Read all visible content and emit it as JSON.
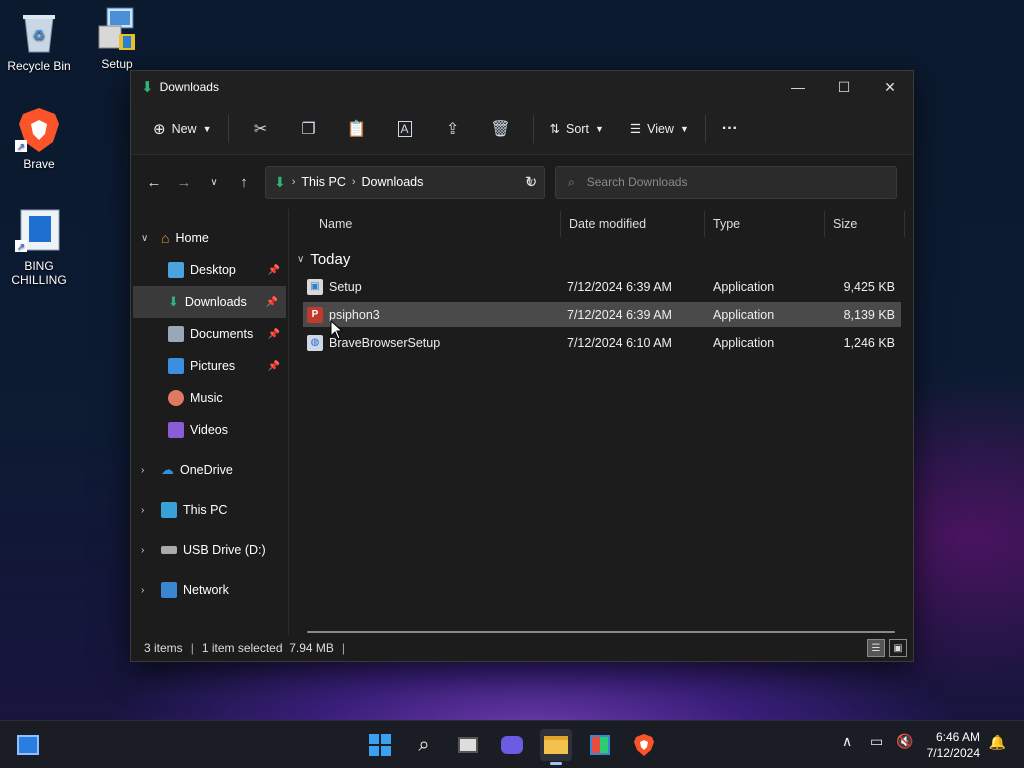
{
  "desktop": {
    "icons": [
      {
        "label": "Recycle Bin",
        "icon": "recycle-bin-icon"
      },
      {
        "label": "Setup",
        "icon": "setup-installer-icon"
      },
      {
        "label": "Brave",
        "icon": "brave-icon"
      },
      {
        "label": "BING CHILLING",
        "icon": "document-shortcut-icon"
      }
    ]
  },
  "window": {
    "title": "Downloads",
    "controls": {
      "minimize": "—",
      "maximize": "☐",
      "close": "✕"
    }
  },
  "toolbar": {
    "new_label": "New",
    "sort_label": "Sort",
    "view_label": "View",
    "more_label": "···",
    "icons": [
      "cut-icon",
      "copy-icon",
      "paste-icon",
      "rename-icon",
      "share-icon",
      "delete-icon"
    ]
  },
  "addressbar": {
    "crumbs": [
      "This PC",
      "Downloads"
    ],
    "search_placeholder": "Search Downloads"
  },
  "navpane": {
    "home": "Home",
    "quick": [
      {
        "label": "Desktop",
        "color": "#4aa3df",
        "pinned": true
      },
      {
        "label": "Downloads",
        "color": "#2fb37a",
        "pinned": true,
        "selected": true
      },
      {
        "label": "Documents",
        "color": "#9aa7b8",
        "pinned": true
      },
      {
        "label": "Pictures",
        "color": "#3b8ee0",
        "pinned": true
      },
      {
        "label": "Music",
        "color": "#e07a5f",
        "pinned": false
      },
      {
        "label": "Videos",
        "color": "#8a5cd6",
        "pinned": false
      }
    ],
    "roots": [
      {
        "label": "OneDrive",
        "color": "#2f8fe0"
      },
      {
        "label": "This PC",
        "color": "#3aa0d8"
      },
      {
        "label": "USB Drive (D:)",
        "color": "#aaaaaa"
      },
      {
        "label": "Network",
        "color": "#3a86d0"
      }
    ]
  },
  "columns": {
    "name": "Name",
    "date": "Date modified",
    "type": "Type",
    "size": "Size"
  },
  "group": "Today",
  "files": [
    {
      "name": "Setup",
      "date": "7/12/2024 6:39 AM",
      "type": "Application",
      "size": "9,425 KB",
      "selected": false,
      "icon": "setup-app-icon"
    },
    {
      "name": "psiphon3",
      "date": "7/12/2024 6:39 AM",
      "type": "Application",
      "size": "8,139 KB",
      "selected": true,
      "icon": "psiphon-icon"
    },
    {
      "name": "BraveBrowserSetup",
      "date": "7/12/2024 6:10 AM",
      "type": "Application",
      "size": "1,246 KB",
      "selected": false,
      "icon": "installer-icon"
    }
  ],
  "status": {
    "count": "3 items",
    "selection": "1 item selected  7.94 MB"
  },
  "taskbar": {
    "apps": [
      "windows-start-icon",
      "search-icon",
      "task-view-icon",
      "chat-icon",
      "file-explorer-icon",
      "store-icon",
      "brave-icon"
    ],
    "time": "6:46 AM",
    "date": "7/12/2024"
  },
  "colors": {
    "accent": "#2fb37a",
    "window_bg": "#1c1c1c",
    "selection": "#4a4a4a"
  }
}
